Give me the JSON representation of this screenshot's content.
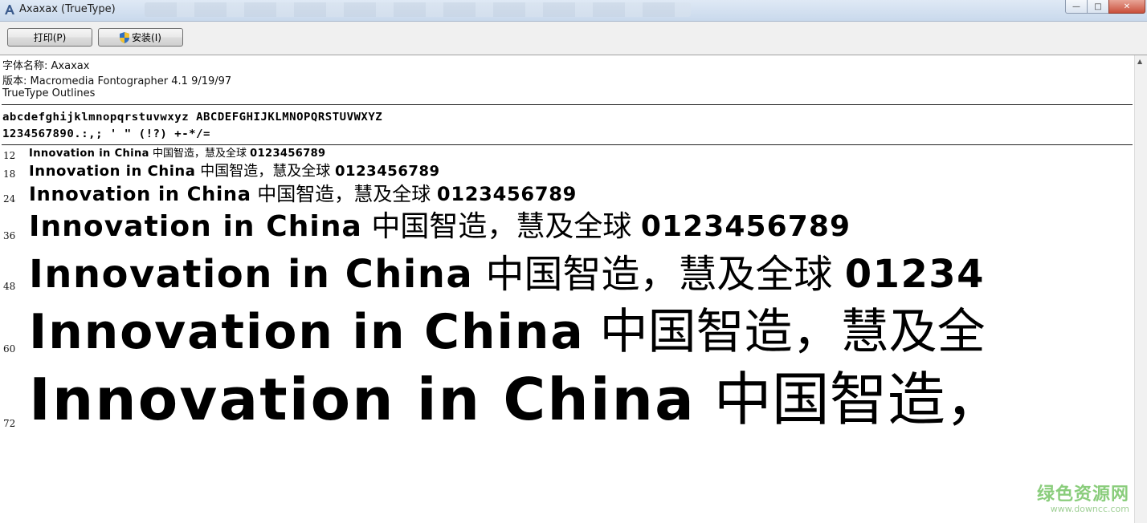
{
  "window": {
    "title": "Axaxax (TrueType)",
    "controls": {
      "minimize": "—",
      "maximize": "□",
      "close": "✕"
    }
  },
  "toolbar": {
    "print_label": "打印(P)",
    "install_label": "安装(I)"
  },
  "font_info": {
    "name_line": "字体名称: Axaxax",
    "version_line": "版本: Macromedia Fontographer 4.1 9/19/97",
    "outline_line": "TrueType Outlines"
  },
  "charset": {
    "line1": "abcdefghijklmnopqrstuvwxyz ABCDEFGHIJKLMNOPQRSTUVWXYZ",
    "line2": "1234567890.:,; ' \" (!?) +-*/="
  },
  "samples": [
    {
      "size": "12",
      "latin": "Innovation in China",
      "cjk": "中国智造，慧及全球",
      "digits": "0123456789"
    },
    {
      "size": "18",
      "latin": "Innovation in China",
      "cjk": "中国智造，慧及全球",
      "digits": "0123456789"
    },
    {
      "size": "24",
      "latin": "Innovation in China",
      "cjk": "中国智造，慧及全球",
      "digits": "0123456789"
    },
    {
      "size": "36",
      "latin": "Innovation in China",
      "cjk": "中国智造，慧及全球",
      "digits": "0123456789"
    },
    {
      "size": "48",
      "latin": "Innovation in China",
      "cjk": "中国智造，慧及全球",
      "digits": "01234"
    },
    {
      "size": "60",
      "latin": "Innovation in China",
      "cjk": "中国智造，慧及全",
      "digits": ""
    },
    {
      "size": "72",
      "latin": "Innovation in China",
      "cjk": "中国智造，",
      "digits": ""
    }
  ],
  "watermark": {
    "brand": "绿色资源网",
    "url": "www.downcc.com"
  },
  "colors": {
    "watermark_green": "#7ec86e",
    "close_red": "#c9503c"
  }
}
